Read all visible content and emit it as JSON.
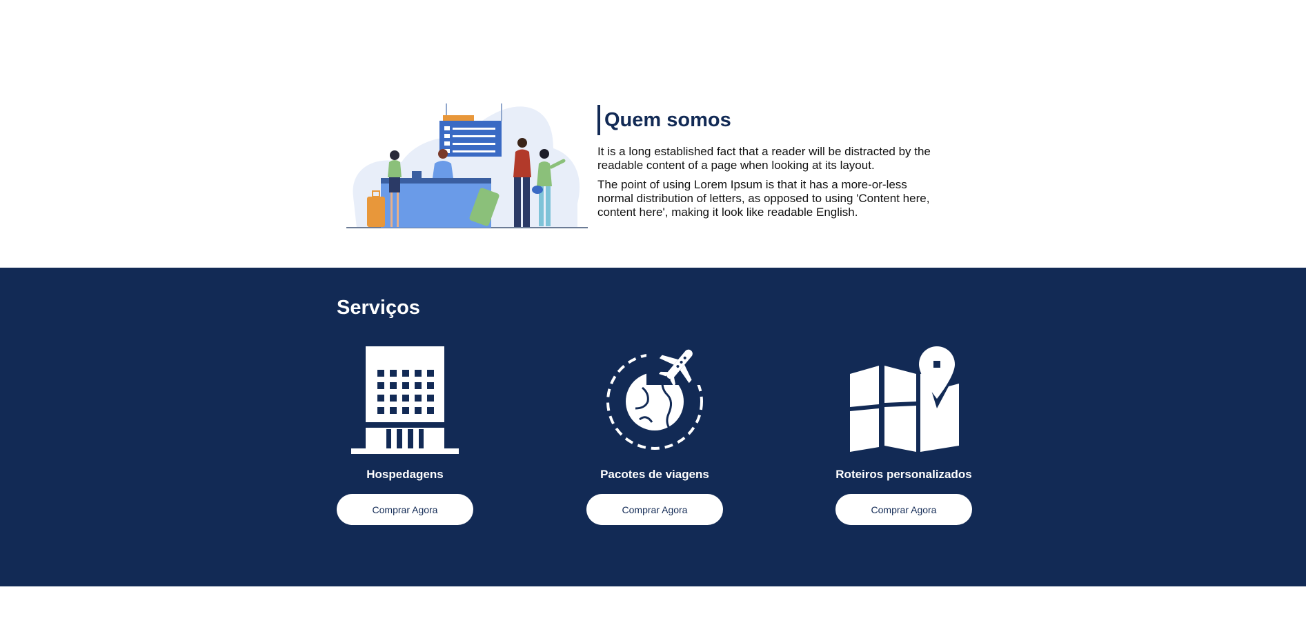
{
  "about": {
    "title": "Quem somos",
    "paragraphs": [
      "It is a long established fact that a reader will be distracted by the readable content of a page when looking at its layout.",
      "The point of using Lorem Ipsum is that it has a more-or-less normal distribution of letters, as opposed to using 'Content here, content here', making it look like readable English."
    ],
    "illustration": "airport-check-in-illustration"
  },
  "services": {
    "title": "Serviços",
    "items": [
      {
        "icon": "hotel-building-icon",
        "name": "Hospedagens",
        "button": "Comprar Agora"
      },
      {
        "icon": "globe-airplane-icon",
        "name": "Pacotes de viagens",
        "button": "Comprar Agora"
      },
      {
        "icon": "map-pin-icon",
        "name": "Roteiros personalizados",
        "button": "Comprar Agora"
      }
    ]
  },
  "colors": {
    "primary": "#122a55",
    "background": "#ffffff",
    "illustration_blue": "#6a9be8",
    "illustration_orange": "#e8973a",
    "illustration_green": "#8bc07a"
  }
}
